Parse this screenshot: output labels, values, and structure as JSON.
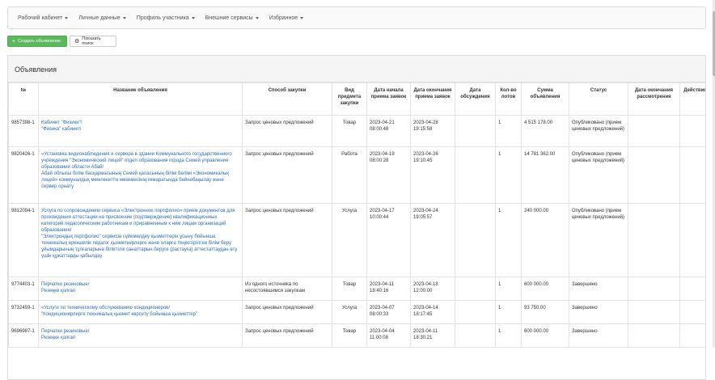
{
  "nav": {
    "items": [
      {
        "label": "Рабочий кабинет"
      },
      {
        "label": "Личные данные"
      },
      {
        "label": "Профиль участника"
      },
      {
        "label": "Внешние сервисы"
      },
      {
        "label": "Избранное"
      }
    ]
  },
  "toolbar": {
    "create_label": "Создать объявление",
    "search_label": "Показать поиск"
  },
  "panel": {
    "title": "Объявления"
  },
  "table": {
    "headers": [
      "№",
      "Название объявления",
      "Способ закупки",
      "Вид предмета закупки",
      "Дата начала приема заявок",
      "Дата окончания приема заявок",
      "Дата обсуждения",
      "Кол-во лотов",
      "Сумма объявления",
      "Статус",
      "Дата окончания рассмотрения",
      "Действия"
    ],
    "rows": [
      {
        "id": "9857398-1",
        "name": [
          "Кабинет \"Физики\"/",
          "\"Физика\" кабинеті"
        ],
        "method": "Запрос ценовых предложений",
        "type": "Товар",
        "start": "2023-04-21 08:00:48",
        "end": "2023-04-28 19:15:58",
        "discussion": "",
        "lots": "1",
        "sum": "4 515 178.00",
        "status": "Опубликовано (прием ценовых предложений)",
        "review_end": "",
        "actions": ""
      },
      {
        "id": "9820426-1",
        "name": [
          "«Установка видеонаблюдения и сервера в здании Коммунального государственного учреждения \"Экономический лицей\" отдел образования города Семей управления образования области Абай/",
          "Абай облысы білім басқармасының Семей қаласының білім бөлімі «Экономикалық лицей» коммуналдық мемлекеттік мекемесінің ғимаратында бейнебақылау және сервер орнату"
        ],
        "method": "Запрос ценовых предложений",
        "type": "Работа",
        "start": "2023-04-19 08:00:28",
        "end": "2023-04-26 19:10:45",
        "discussion": "",
        "lots": "1",
        "sum": "14 781 362.00",
        "status": "Опубликовано (прием ценовых предложений)",
        "review_end": "",
        "actions": ""
      },
      {
        "id": "9812094-1",
        "name": [
          "Услуга по сопровождению сервиса «Электронное портфолио» прием документов для прохождения аттестации на присвоение (подтверждение) квалификационных категорий педагогическим работникам и приравненным к ним лицам организаций образования/",
          "\"Электрондық портфолио\" сервисін сүйемелдеу қызметтерін ұсыну бойынша техникалық ерекшелік педагог қызметкерлерге және оларға теңестірілген білім беру ұйымдарының тұлғаларына біліктілік санаттарын беруге (растауға) аттестаттаудан өту үшін құжаттарды қабылдау"
        ],
        "method": "Запрос ценовых предложений",
        "type": "Услуга",
        "start": "2023-04-17 10:00:44",
        "end": "2023-04-24 19:05:57",
        "discussion": "",
        "lots": "1",
        "sum": "240 000.00",
        "status": "Опубликовано (прием ценовых предложений)",
        "review_end": "",
        "actions": ""
      },
      {
        "id": "9774403-1",
        "name": [
          "Перчатки резиновые/",
          "Резеңке қолғап"
        ],
        "method": "Из одного источника по несостоявшимся закупкам",
        "type": "Товар",
        "start": "2023-04-11 18:40:16",
        "end": "2023-04-18 12:00:00",
        "discussion": "",
        "lots": "1",
        "sum": "600 000.00",
        "status": "Завершено",
        "review_end": "",
        "actions": ""
      },
      {
        "id": "9732459-1",
        "name": [
          "«Услуги по техническому обслуживанию кондиционеров/",
          "\"Кондиционерлерге техникалық қызмет көрсету бойынша қызметтер\""
        ],
        "method": "Запрос ценовых предложений",
        "type": "Услуга",
        "start": "2023-04-07 08:00:33",
        "end": "2023-04-14 18:17:45",
        "discussion": "",
        "lots": "1",
        "sum": "93 750.00",
        "status": "Завершено",
        "review_end": "",
        "actions": ""
      },
      {
        "id": "9696987-1",
        "name": [
          "Перчатки резиновые/",
          "Резеңке қолғап"
        ],
        "method": "Запрос ценовых предложений",
        "type": "Товар",
        "start": "2023-04-04 11:00:08",
        "end": "2023-04-11 18:30:21",
        "discussion": "",
        "lots": "1",
        "sum": "600 000.00",
        "status": "Завершено",
        "review_end": "",
        "actions": ""
      }
    ]
  }
}
